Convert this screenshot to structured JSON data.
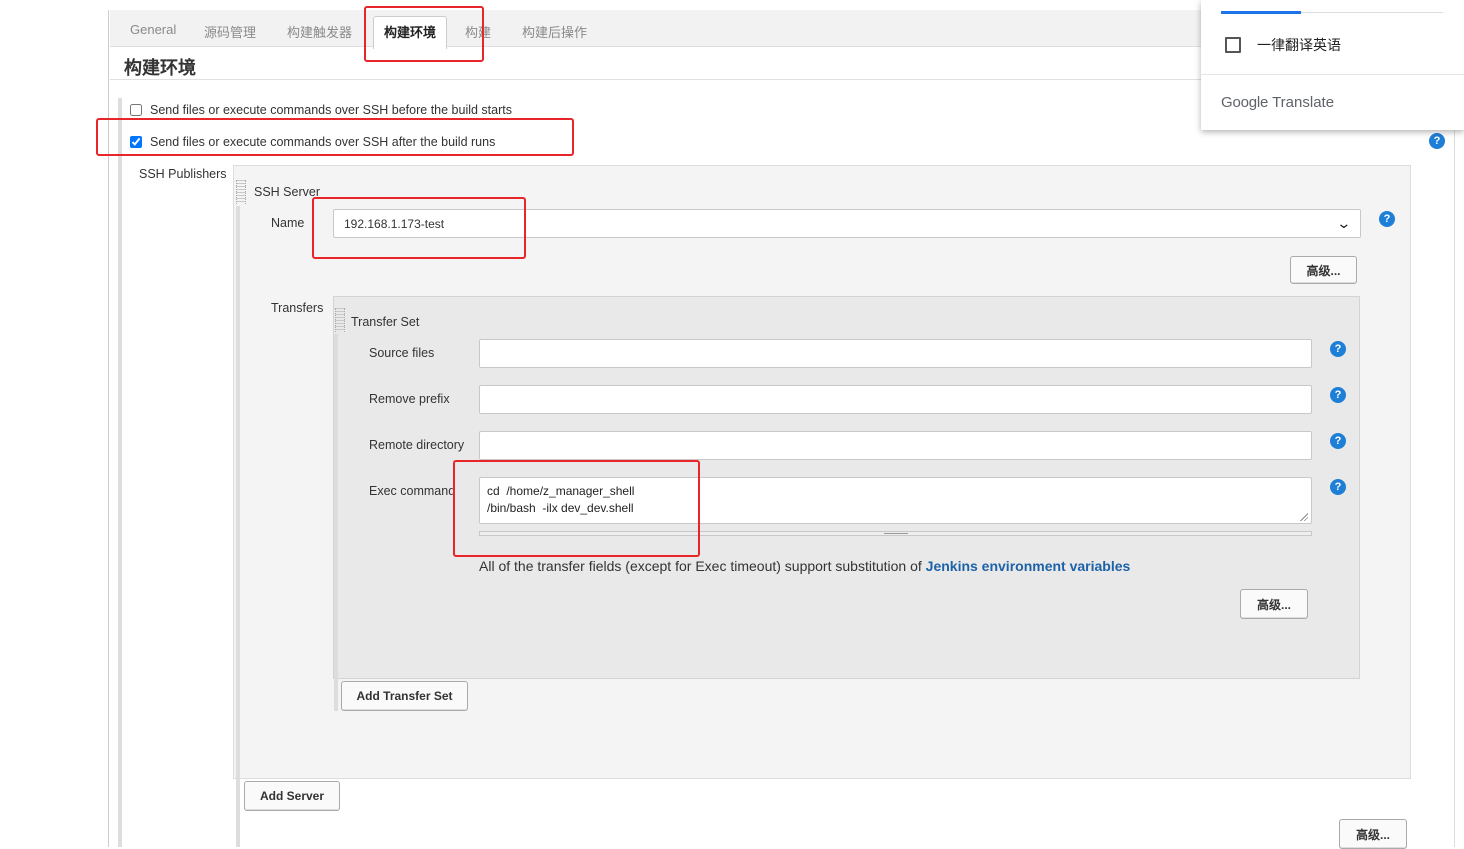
{
  "tabs": [
    "General",
    "源码管理",
    "构建触发器",
    "构建环境",
    "构建",
    "构建后操作"
  ],
  "section_title": "构建环境",
  "options": {
    "ssh_before": {
      "label": "Send files or execute commands over SSH before the build starts",
      "checked": false
    },
    "ssh_after": {
      "label": "Send files or execute commands over SSH after the build runs",
      "checked": true
    }
  },
  "ssh_publishers": {
    "label": "SSH Publishers",
    "server_label": "SSH Server",
    "name_label": "Name",
    "name_value": "192.168.1.173-test",
    "advanced_label": "高级...",
    "transfers_label": "Transfers",
    "transfer_set": {
      "title": "Transfer Set",
      "source_files_label": "Source files",
      "source_files_value": "",
      "remove_prefix_label": "Remove prefix",
      "remove_prefix_value": "",
      "remote_directory_label": "Remote directory",
      "remote_directory_value": "",
      "exec_command_label": "Exec command",
      "exec_command_value": "cd  /home/z_manager_shell\n/bin/bash  -ilx dev_dev.shell",
      "note_text": "All of the transfer fields (except for Exec timeout) support substitution of ",
      "note_link": "Jenkins environment variables",
      "advanced_label": "高级..."
    },
    "add_transfer_set_label": "Add Transfer Set",
    "add_server_label": "Add Server",
    "bottom_advanced_label": "高级..."
  },
  "translate_popup": {
    "option_label": "一律翻译英语",
    "brand_google": "Google",
    "brand_translate": "Translate"
  },
  "help_glyph": "?",
  "chevron_glyph": "⌄"
}
